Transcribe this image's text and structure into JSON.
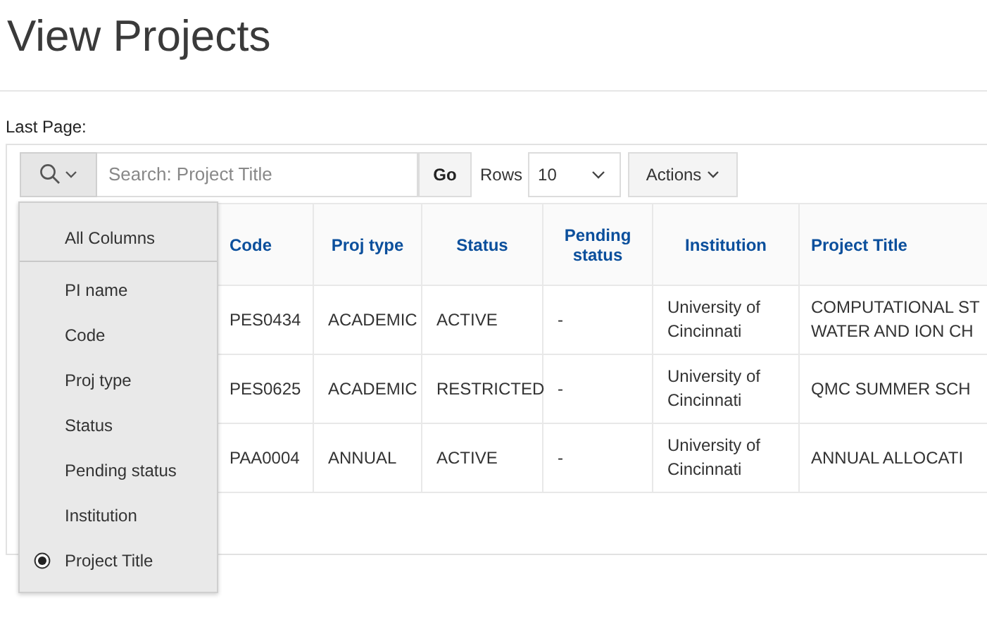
{
  "page": {
    "title": "View Projects",
    "last_page_label": "Last Page:"
  },
  "toolbar": {
    "search_placeholder": "Search: Project Title",
    "go": "Go",
    "rows_label": "Rows",
    "rows_value": "10",
    "actions": "Actions"
  },
  "table": {
    "columns": [
      "Code",
      "Proj type",
      "Status",
      "Pending status",
      "Institution",
      "Project Title"
    ],
    "rows": [
      {
        "cells": [
          "PES0434",
          "ACADEMIC",
          "ACTIVE",
          "-",
          "University of Cincinnati"
        ],
        "title_lines": [
          "COMPUTATIONAL ST",
          "WATER AND ION CH"
        ]
      },
      {
        "cells": [
          "PES0625",
          "ACADEMIC",
          "RESTRICTED",
          "-",
          "University of Cincinnati"
        ],
        "title_lines": [
          "QMC SUMMER SCH"
        ]
      },
      {
        "cells": [
          "PAA0004",
          "ANNUAL",
          "ACTIVE",
          "-",
          "University of Cincinnati"
        ],
        "title_lines": [
          "ANNUAL ALLOCATI"
        ]
      }
    ]
  },
  "search_menu": {
    "items": [
      {
        "label": "All Columns",
        "selected": false
      },
      {
        "label": "PI name",
        "selected": false
      },
      {
        "label": "Code",
        "selected": false
      },
      {
        "label": "Proj type",
        "selected": false
      },
      {
        "label": "Status",
        "selected": false
      },
      {
        "label": "Pending status",
        "selected": false
      },
      {
        "label": "Institution",
        "selected": false
      },
      {
        "label": "Project Title",
        "selected": true
      }
    ]
  }
}
